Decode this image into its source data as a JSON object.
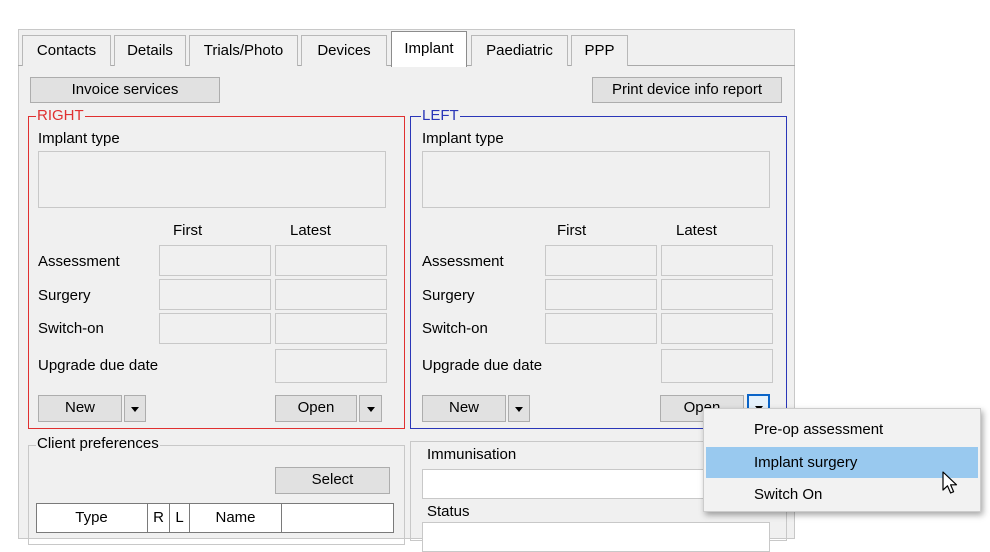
{
  "tabs": [
    "Contacts",
    "Details",
    "Trials/Photo",
    "Devices",
    "Implant",
    "Paediatric",
    "PPP"
  ],
  "toolbar": {
    "invoice_label": "Invoice services",
    "print_label": "Print device info report"
  },
  "right": {
    "legend": "RIGHT",
    "implant_type_label": "Implant type",
    "first_label": "First",
    "latest_label": "Latest",
    "rows": [
      "Assessment",
      "Surgery",
      "Switch-on"
    ],
    "upgrade_label": "Upgrade due date",
    "new_label": "New",
    "open_label": "Open"
  },
  "left": {
    "legend": "LEFT",
    "implant_type_label": "Implant type",
    "first_label": "First",
    "latest_label": "Latest",
    "rows": [
      "Assessment",
      "Surgery",
      "Switch-on"
    ],
    "upgrade_label": "Upgrade due date",
    "new_label": "New",
    "open_label": "Open"
  },
  "client_prefs": {
    "legend": "Client preferences",
    "select_label": "Select",
    "columns": [
      "Type",
      "R",
      "L",
      "Name"
    ]
  },
  "immunisation": {
    "label": "Immunisation",
    "status_label": "Status"
  },
  "dropdown_menu": {
    "items": [
      "Pre-op assessment",
      "Implant surgery",
      "Switch On"
    ],
    "highlighted_item": "Implant surgery"
  },
  "colors": {
    "right_border": "#e03030",
    "left_border": "#2a36b8",
    "menu_highlight": "#99c9ef"
  }
}
